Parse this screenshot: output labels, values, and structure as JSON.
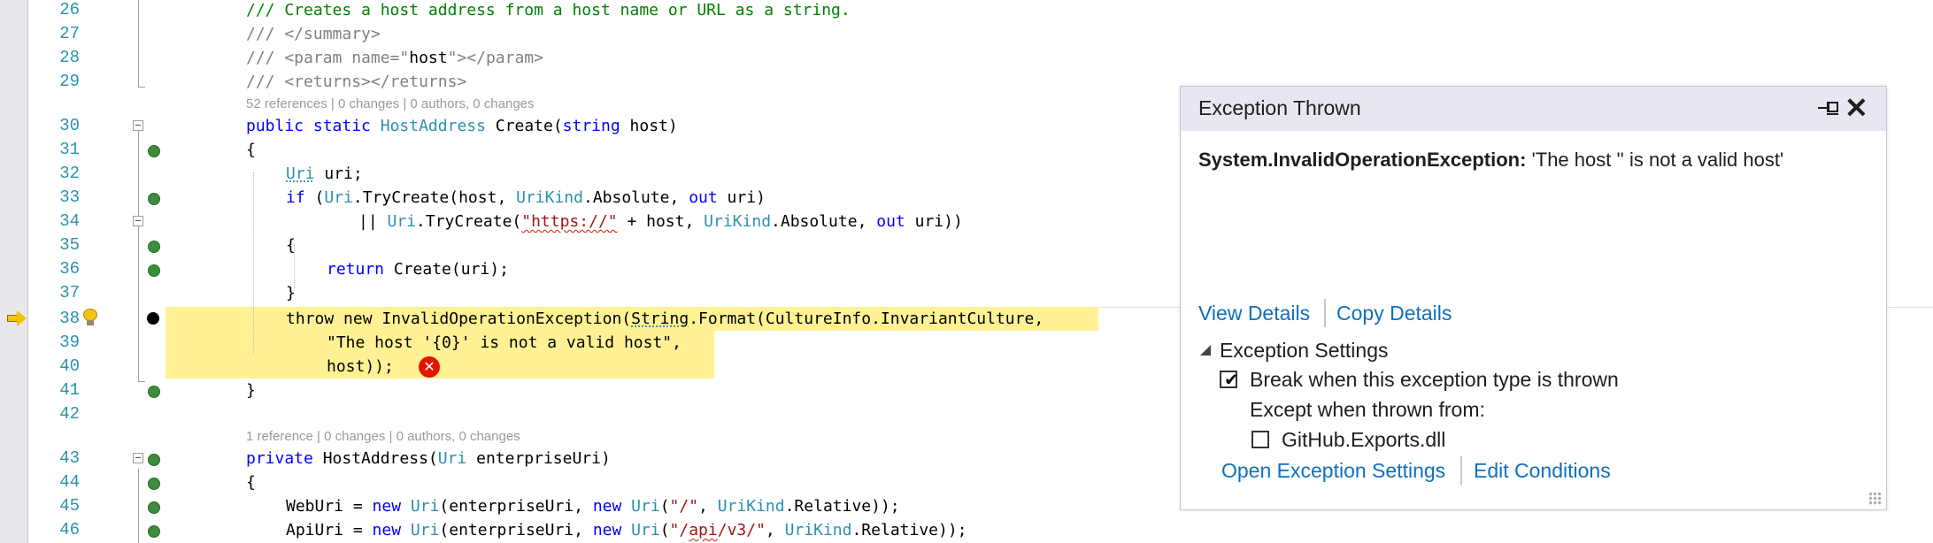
{
  "editor": {
    "lines": [
      {
        "n": "26"
      },
      {
        "n": "27"
      },
      {
        "n": "28"
      },
      {
        "n": "29"
      },
      {
        "n": "30"
      },
      {
        "n": "31"
      },
      {
        "n": "32"
      },
      {
        "n": "33"
      },
      {
        "n": "34"
      },
      {
        "n": "35"
      },
      {
        "n": "36"
      },
      {
        "n": "37"
      },
      {
        "n": "38"
      },
      {
        "n": "39"
      },
      {
        "n": "40"
      },
      {
        "n": "41"
      },
      {
        "n": "42"
      },
      {
        "n": "43"
      },
      {
        "n": "44"
      },
      {
        "n": "45"
      },
      {
        "n": "46"
      }
    ],
    "codelens_create": "52 references | 0 changes | 0 authors, 0 changes",
    "codelens_ctor": "1 reference | 0 changes | 0 authors, 0 changes",
    "code": {
      "l26": "/// Creates a host address from a host name or URL as a string.",
      "l27": "/// </summary>",
      "l28a": "/// <param name=\"",
      "l28b": "host",
      "l28c": "\"></param>",
      "l29": "/// <returns></returns>",
      "public": "public",
      "static": "static",
      "HostAddress": "HostAddress",
      "Create_sig": " Create(",
      "string": "string",
      "host_param": " host)",
      "brace_open": "{",
      "brace_close": "}",
      "Uri": "Uri",
      "uri_decl": " uri;",
      "if": "if",
      "l33_a": " (",
      "l33_b": ".TryCreate(host, ",
      "UriKind": "UriKind",
      "l33_c": ".Absolute, ",
      "out": "out",
      "l33_d": " uri)",
      "l34_a": "|| ",
      "l34_b": ".TryCreate(",
      "l34_str": "\"https://\"",
      "l34_c": " + host, ",
      "l34_d": ".Absolute, ",
      "l34_e": " uri))",
      "return": "return",
      "l36": " Create(uri);",
      "throw": "throw",
      "new": "new",
      "l38_a": " InvalidOperationException(",
      "String": "String",
      "l38_b": ".Format(CultureInfo.InvariantCulture,",
      "l39": "\"The host '{0}' is not a valid host\",",
      "l40": "host));",
      "private": "private",
      "l43_a": " HostAddress(",
      "l43_b": " enterpriseUri)",
      "l45_a": "WebUri = ",
      "l45_b": "(enterpriseUri, ",
      "l45_str": "\"/\"",
      "l45_c": ", ",
      "l45_d": ".Relative));",
      "l46_a": "ApiUri = ",
      "l46_str1": "\"/",
      "l46_str2": "api",
      "l46_str3": "/v3/\""
    }
  },
  "popup": {
    "title": "Exception Thrown",
    "exception_type": "System.InvalidOperationException:",
    "exception_message": "'The host '' is not a valid host'",
    "view_details": "View Details",
    "copy_details": "Copy Details",
    "settings_header": "Exception Settings",
    "break_when": "Break when this exception type is thrown",
    "break_checked": true,
    "except_when": "Except when thrown from:",
    "exports_dll": "GitHub.Exports.dll",
    "exports_checked": false,
    "open_settings": "Open Exception Settings",
    "edit_conditions": "Edit Conditions"
  },
  "colors": {
    "keyword": "#0000ff",
    "type": "#2b91af",
    "string": "#a31515",
    "comment": "#008000",
    "highlight": "#fff194",
    "link": "#0e70c0"
  }
}
